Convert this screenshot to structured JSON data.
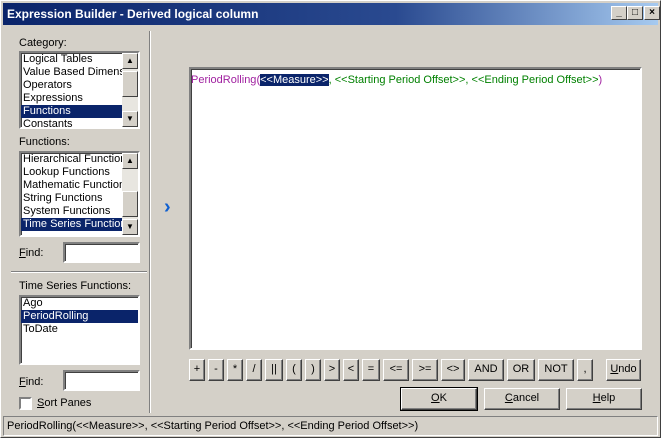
{
  "window": {
    "title": "Expression Builder - Derived logical column",
    "minimize_glyph": "_",
    "maximize_glyph": "□",
    "close_glyph": "×"
  },
  "category": {
    "label_prefix": "Category",
    "label_suffix": ":",
    "items": [
      "Logical Tables",
      "Value Based Dimensi",
      "Operators",
      "Expressions",
      "Functions",
      "Constants"
    ],
    "selected": "Functions"
  },
  "functions": {
    "label": "Functions:",
    "items": [
      "Hierarchical Function",
      "Lookup Functions",
      "Mathematic Function",
      "String Functions",
      "System Functions",
      "Time Series Function"
    ],
    "selected": "Time Series Function"
  },
  "find1": {
    "label_first": "F",
    "label_rest": "ind:",
    "value": ""
  },
  "sub_functions": {
    "label": "Time Series Functions:",
    "items": [
      "Ago",
      "PeriodRolling",
      "ToDate"
    ],
    "selected": "PeriodRolling"
  },
  "find2": {
    "label_first": "F",
    "label_rest": "ind:",
    "value": ""
  },
  "sort_panes": {
    "label_first": "S",
    "label_rest": "ort Panes",
    "checked": false
  },
  "insert_arrow": "›",
  "expression": {
    "fn": "PeriodRolling",
    "open": "(",
    "p1": "<<Measure>>",
    "sep1": ", ",
    "p2": "<<Starting Period Offset>>",
    "sep2": ", ",
    "p3": "<<Ending Period Offset>>",
    "close": ")"
  },
  "operators": [
    "+",
    "-",
    "*",
    "/",
    "||",
    "(",
    ")",
    ">",
    "<",
    "=",
    "<=",
    ">=",
    "<>",
    "AND",
    "OR",
    "NOT",
    ","
  ],
  "undo": {
    "first": "U",
    "rest": "ndo"
  },
  "ok": {
    "first": "O",
    "rest": "K"
  },
  "cancel": {
    "first": "C",
    "rest": "ancel"
  },
  "help": {
    "first": "H",
    "rest": "elp"
  },
  "status": "PeriodRolling(<<Measure>>, <<Starting Period Offset>>, <<Ending Period Offset>>)"
}
